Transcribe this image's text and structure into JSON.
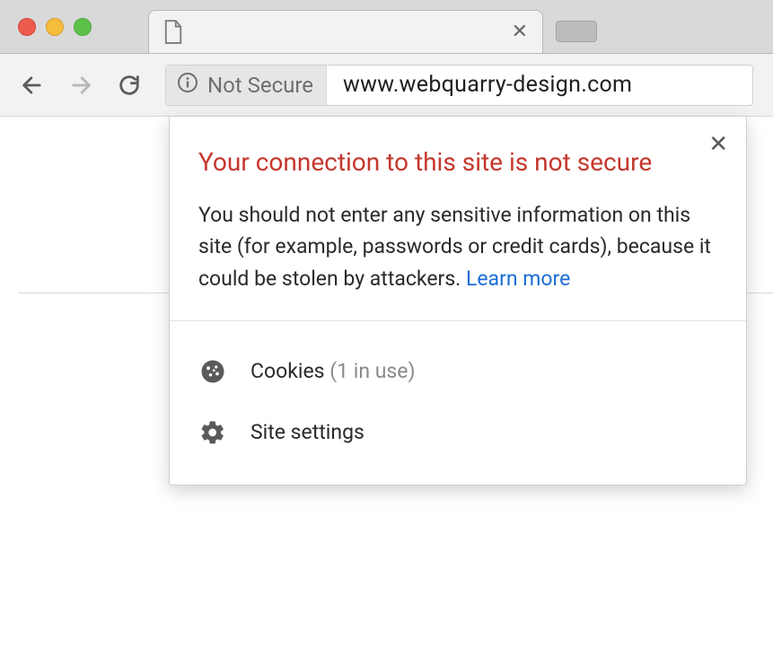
{
  "security_chip": {
    "label": "Not Secure"
  },
  "omnibox": {
    "url": "www.webquarry-design.com"
  },
  "popover": {
    "title": "Your connection to this site is not secure",
    "description": "You should not enter any sensitive information on this site (for example, passwords or credit cards), because it could be stolen by attackers. ",
    "learn_more": "Learn more",
    "cookies_label": "Cookies",
    "cookies_count": "(1 in use)",
    "site_settings_label": "Site settings"
  }
}
